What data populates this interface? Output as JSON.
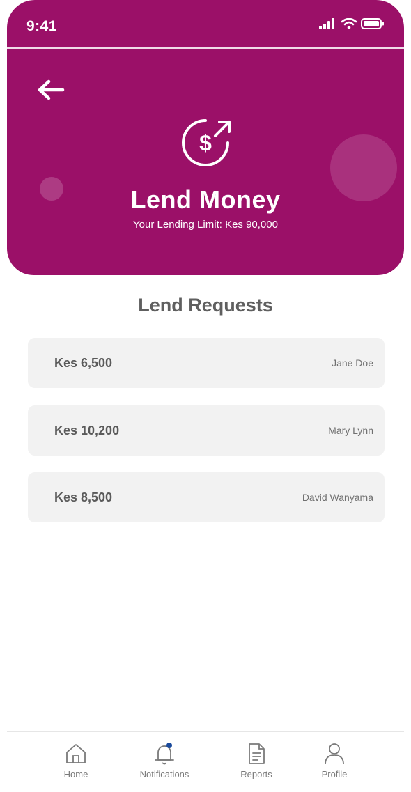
{
  "status_bar": {
    "time": "9:41"
  },
  "header": {
    "title": "Lend Money",
    "lending_limit": "Your Lending Limit: Kes 90,000",
    "back_icon": "arrow-left-icon",
    "hero_icon": "dollar-transfer-icon",
    "background_color": "#9b1068"
  },
  "section": {
    "title": "Lend Requests"
  },
  "requests": [
    {
      "amount": "Kes 6,500",
      "name": "Jane Doe"
    },
    {
      "amount": "Kes 10,200",
      "name": "Mary Lynn"
    },
    {
      "amount": "Kes 8,500",
      "name": "David Wanyama"
    }
  ],
  "bottom_nav": {
    "items": [
      {
        "label": "Home",
        "icon": "home-icon"
      },
      {
        "label": "Notifications",
        "icon": "bell-icon",
        "has_badge": true
      },
      {
        "label": "Reports",
        "icon": "document-icon"
      },
      {
        "label": "Profile",
        "icon": "user-icon"
      }
    ],
    "badge_color": "#1a4a9c"
  }
}
